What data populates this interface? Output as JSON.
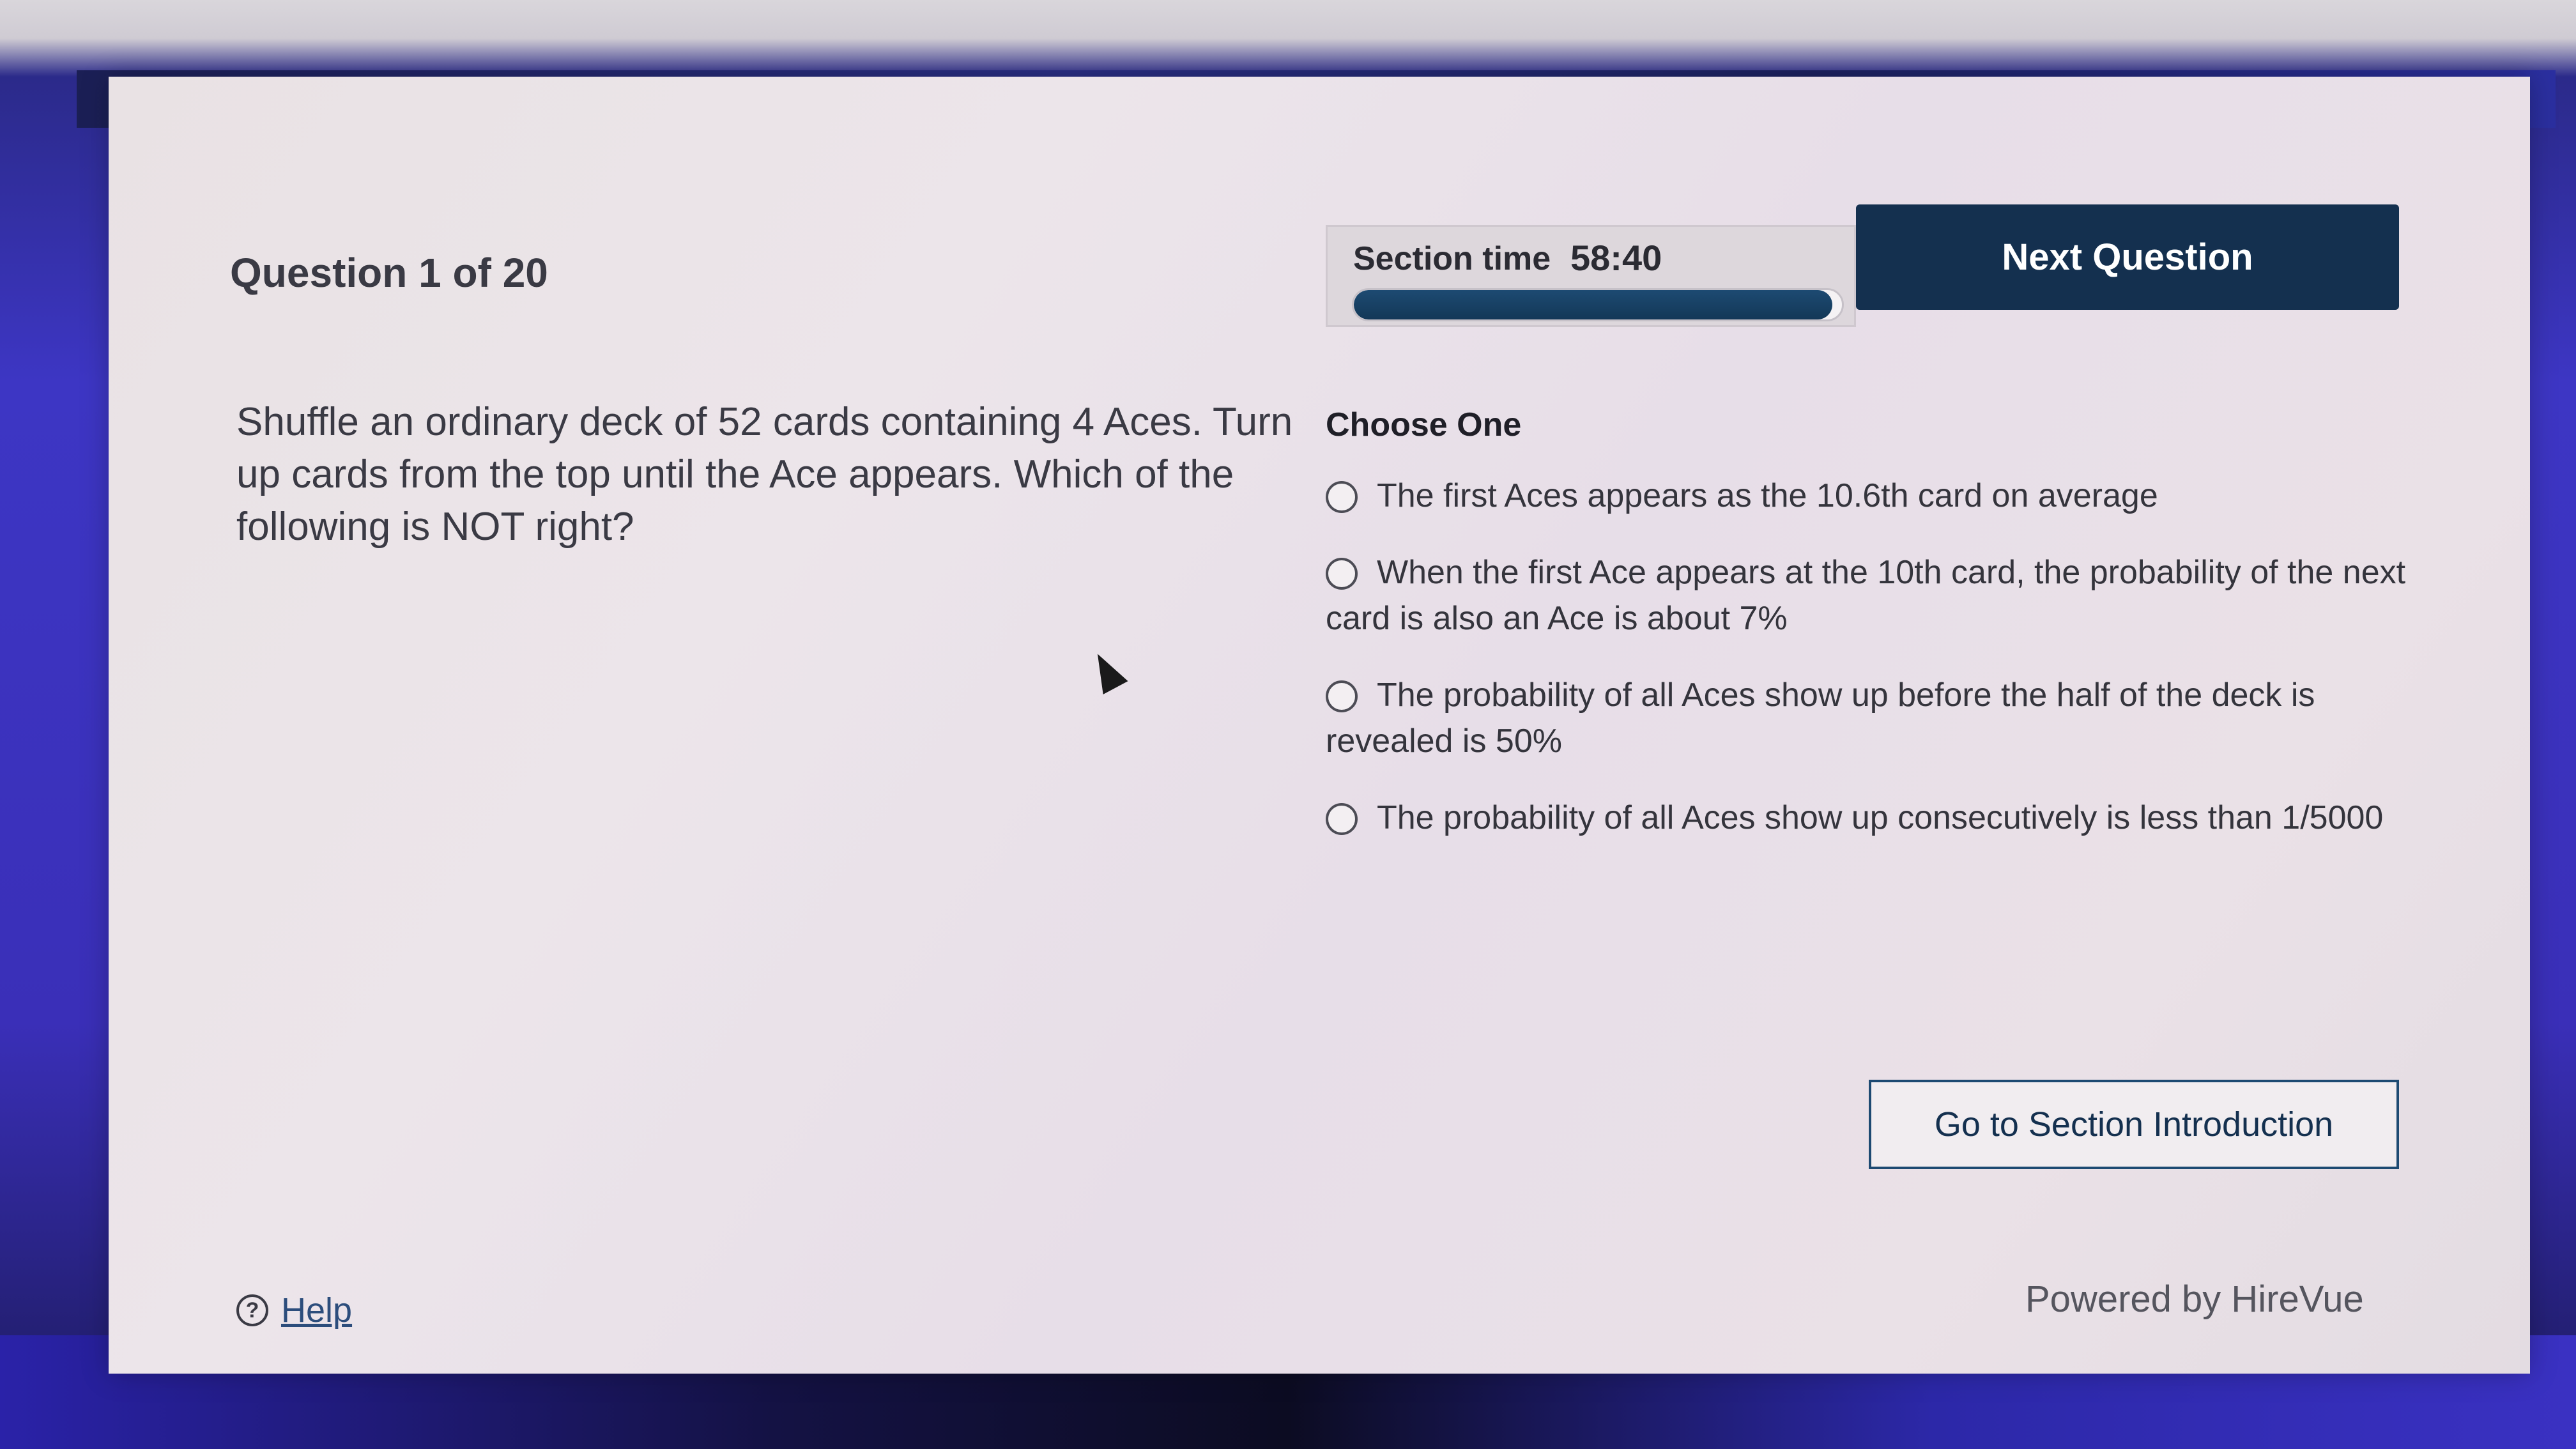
{
  "header": {
    "question_counter": "Question 1 of 20",
    "timer_label": "Section time",
    "timer_value": "58:40",
    "timer_progress_percent": 98,
    "next_button_label": "Next Question"
  },
  "question": {
    "text": "Shuffle an ordinary deck of 52 cards containing 4 Aces. Turn up cards from the top until the Ace appears. Which of the following is NOT right?"
  },
  "answers": {
    "heading": "Choose One",
    "options": [
      "The first Aces appears as the 10.6th card on average",
      "When the first Ace appears at the 10th card, the probability of the next card is also an Ace is about 7%",
      "The probability of all Aces show up before the half of the deck is revealed is 50%",
      "The probability of all Aces show up consecutively is less than 1/5000"
    ]
  },
  "footer": {
    "section_intro_label": "Go to Section Introduction",
    "help_label": "Help",
    "powered_by": "Powered by HireVue"
  },
  "icons": {
    "help": "question-circle-icon",
    "cursor": "mouse-pointer-icon"
  },
  "colors": {
    "primary": "#14304f",
    "progress": "#1d4a72",
    "link": "#2c4d7c"
  }
}
